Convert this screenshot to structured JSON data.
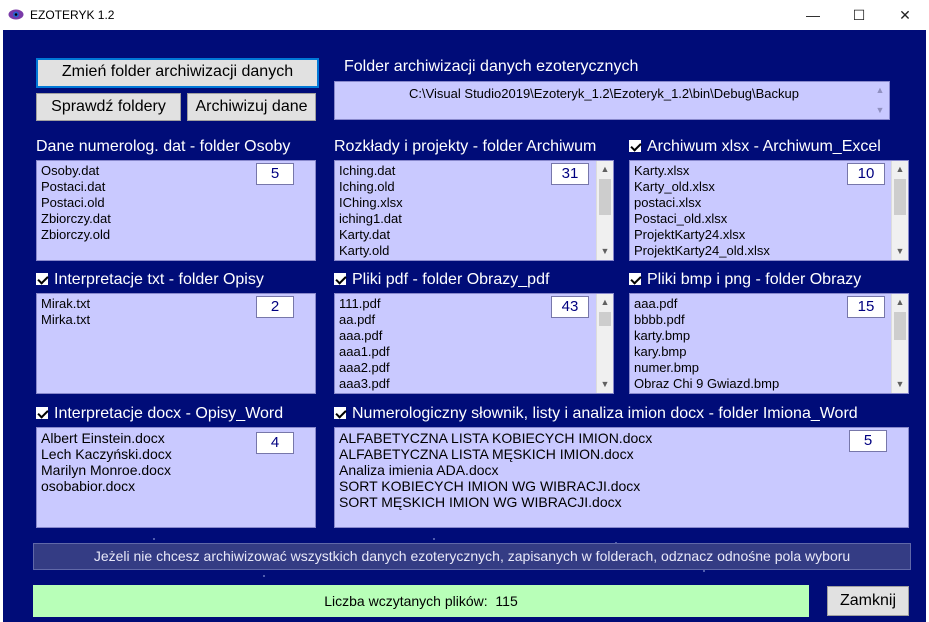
{
  "window": {
    "title": "EZOTERYK 1.2",
    "minimize": "—",
    "maximize": "☐",
    "close": "✕"
  },
  "buttons": {
    "change_folder": "Zmień folder archiwizacji danych",
    "check_folders": "Sprawdź foldery",
    "archive_data": "Archiwizuj dane",
    "close": "Zamknij"
  },
  "archive_folder": {
    "label": "Folder archiwizacji danych ezoterycznych",
    "path": "C:\\Visual Studio2019\\Ezoteryk_1.2\\Ezoteryk_1.2\\bin\\Debug\\Backup"
  },
  "panels": {
    "osoby": {
      "label": "Dane numerolog. dat - folder Osoby",
      "count": "5",
      "items": [
        "Osoby.dat",
        "Postaci.dat",
        "Postaci.old",
        "Zbiorczy.dat",
        "Zbiorczy.old"
      ]
    },
    "archiwum": {
      "label": "Rozkłady i projekty - folder Archiwum",
      "count": "31",
      "items": [
        "Iching.dat",
        "Iching.old",
        "IChing.xlsx",
        "iching1.dat",
        "Karty.dat",
        "Karty.old"
      ]
    },
    "excel": {
      "label": "Archiwum xlsx - Archiwum_Excel",
      "count": "10",
      "items": [
        "Karty.xlsx",
        "Karty_old.xlsx",
        "postaci.xlsx",
        "Postaci_old.xlsx",
        "ProjektKarty24.xlsx",
        "ProjektKarty24_old.xlsx"
      ]
    },
    "opisy": {
      "label": "Interpretacje txt - folder Opisy",
      "count": "2",
      "items": [
        "Mirak.txt",
        "Mirka.txt"
      ]
    },
    "pdf": {
      "label": "Pliki pdf - folder Obrazy_pdf",
      "count": "43",
      "items": [
        "111.pdf",
        "aa.pdf",
        "aaa.pdf",
        "aaa1.pdf",
        "aaa2.pdf",
        "aaa3.pdf"
      ]
    },
    "obrazy": {
      "label": "Pliki bmp i png - folder Obrazy",
      "count": "15",
      "items": [
        "aaa.pdf",
        "bbbb.pdf",
        "karty.bmp",
        "kary.bmp",
        "numer.bmp",
        "Obraz Chi 9 Gwiazd.bmp"
      ]
    },
    "word": {
      "label": "Interpretacje docx - Opisy_Word",
      "count": "4",
      "items": [
        "Albert Einstein.docx",
        "Lech Kaczyński.docx",
        "Marilyn Monroe.docx",
        "osobabior.docx"
      ]
    },
    "imiona": {
      "label": "Numerologiczny słownik, listy i analiza imion docx - folder Imiona_Word",
      "count": "5",
      "items": [
        "ALFABETYCZNA LISTA KOBIECYCH IMION.docx",
        "ALFABETYCZNA LISTA MĘSKICH IMION.docx",
        "Analiza imienia ADA.docx",
        "SORT KOBIECYCH IMION WG WIBRACJI.docx",
        "SORT MĘSKICH IMION WG WIBRACJI.docx"
      ]
    }
  },
  "info": "Jeżeli nie chcesz archiwizować wszystkich danych ezoterycznych, zapisanych w folderach, odznacz odnośne pola wyboru",
  "status": {
    "label": "Liczba wczytanych plików:",
    "value": "115"
  },
  "colors": {
    "background": "#000c78",
    "listbox": "#c9c9ff",
    "status": "#b8ffb8"
  }
}
